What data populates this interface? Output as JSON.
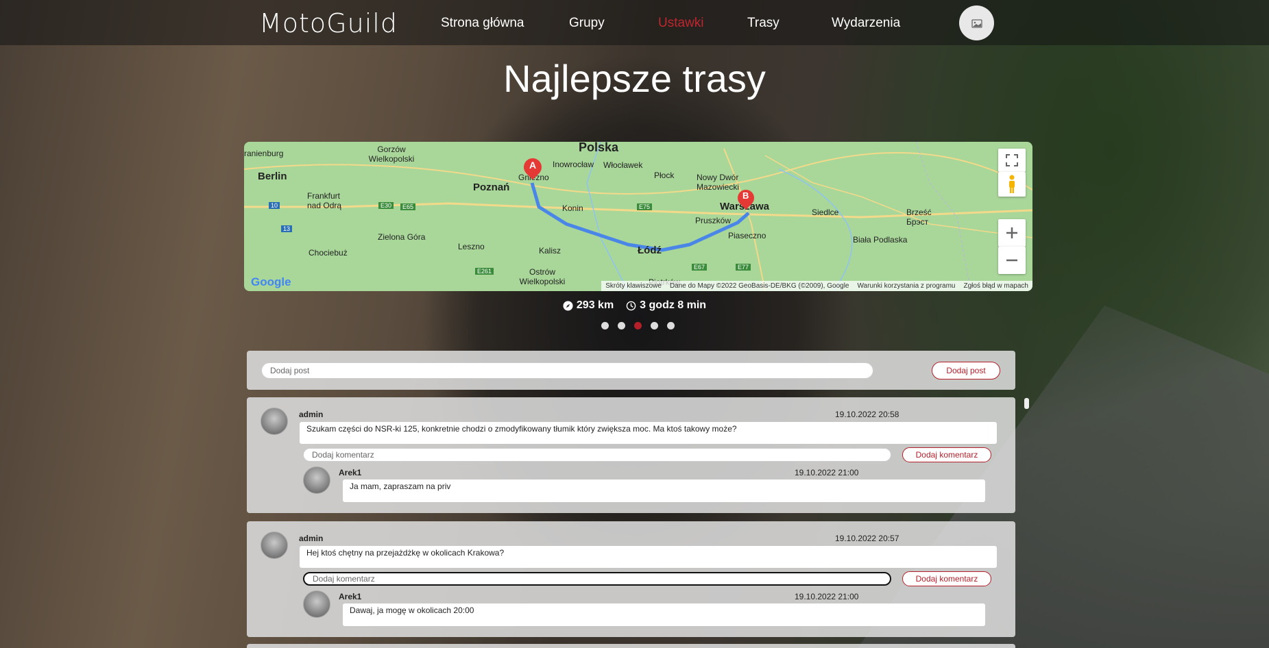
{
  "nav": {
    "logo": "MotoGuild",
    "links": [
      "Strona główna",
      "Grupy",
      "Ustawki",
      "Trasy",
      "Wydarzenia"
    ],
    "active": "Ustawki",
    "avatar_icon": "user-photo-icon"
  },
  "page": {
    "title": "Najlepsze trasy"
  },
  "map": {
    "country_label": "Polska",
    "cities": [
      "Berlin",
      "Gorzów Wielkopolski",
      "Poznań",
      "Gniezno",
      "Inowrocław",
      "Włocławek",
      "Płock",
      "Nowy Dwór Mazowiecki",
      "Warszawa",
      "Frankfurt nad Odrą",
      "Konin",
      "Pruszków",
      "Siedlce",
      "Brześć Брэст",
      "Zielona Góra",
      "Leszno",
      "Kalisz",
      "Łódź",
      "Piaseczno",
      "Biała Podlaska",
      "Chociebuż",
      "Ostrów Wielkopolski",
      "Piotrków",
      "ranienburg"
    ],
    "roads": [
      "E30",
      "E65",
      "E75",
      "E261",
      "E67",
      "E77",
      "10",
      "13",
      "10"
    ],
    "marker_a": "A",
    "marker_b": "B",
    "footer": [
      "Skróty klawiszowe",
      "Dane do Mapy ©2022 GeoBasis-DE/BKG (©2009), Google",
      "Warunki korzystania z programu",
      "Zgłoś błąd w mapach"
    ],
    "google_logo": "Google"
  },
  "route": {
    "distance": "293 km",
    "duration": "3 godz 8 min"
  },
  "carousel": {
    "count": 5,
    "active_index": 2
  },
  "composer": {
    "placeholder": "Dodaj post",
    "button": "Dodaj post"
  },
  "posts": [
    {
      "author": "admin",
      "date": "19.10.2022 20:58",
      "text": "Szukam części do NSR-ki 125, konkretnie chodzi o zmodyfikowany tłumik który zwiększa moc. Ma ktoś takowy może?",
      "comment_placeholder": "Dodaj komentarz",
      "comment_button": "Dodaj komentarz",
      "comments": [
        {
          "author": "Arek1",
          "date": "19.10.2022 21:00",
          "text": "Ja mam, zapraszam na priv"
        }
      ]
    },
    {
      "author": "admin",
      "date": "19.10.2022 20:57",
      "text": "Hej ktoś chętny na przejażdżkę w okolicach Krakowa?",
      "comment_placeholder": "Dodaj komentarz",
      "comment_button": "Dodaj komentarz",
      "comments": [
        {
          "author": "Arek1",
          "date": "19.10.2022 21:00",
          "text": "Dawaj, ja mogę w okolicach 20:00"
        }
      ]
    }
  ],
  "colors": {
    "accent": "#b3202a",
    "nav_active": "#c0262e",
    "map_land": "#a9d79a",
    "route": "#4a86e8"
  }
}
